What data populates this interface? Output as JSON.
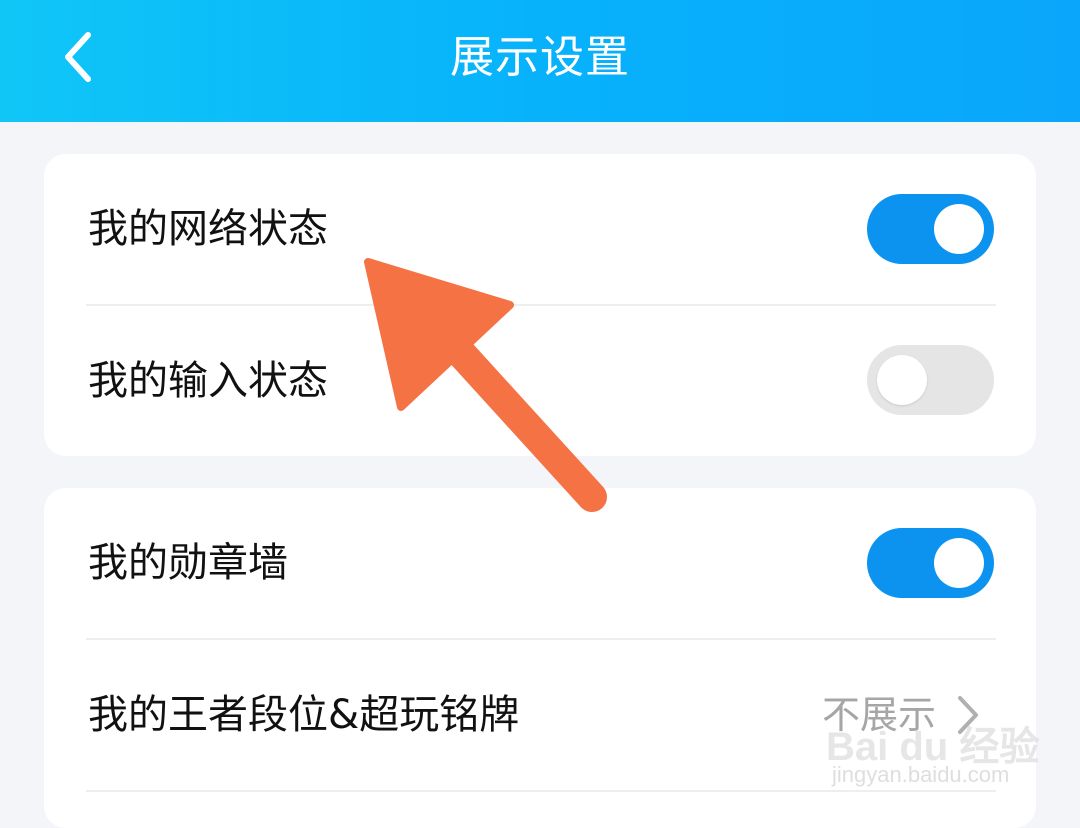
{
  "header": {
    "title": "展示设置",
    "back_icon": "chevron-left-icon"
  },
  "settings": {
    "group1": [
      {
        "label": "我的网络状态",
        "enabled": true
      },
      {
        "label": "我的输入状态",
        "enabled": false
      }
    ],
    "group2": [
      {
        "label": "我的勋章墙",
        "enabled": true
      },
      {
        "label": "我的王者段位&超玩铭牌",
        "value": "不展示",
        "icon": "chevron-right-icon"
      }
    ]
  },
  "colors": {
    "header_start": "#10c6f7",
    "header_end": "#0aa6fb",
    "toggle_on": "#0b93ef",
    "toggle_off": "#e5e5e5",
    "annotation_arrow": "#f57245"
  },
  "watermark": {
    "brand": "Bai du 经验",
    "url": "jingyan.baidu.com"
  }
}
